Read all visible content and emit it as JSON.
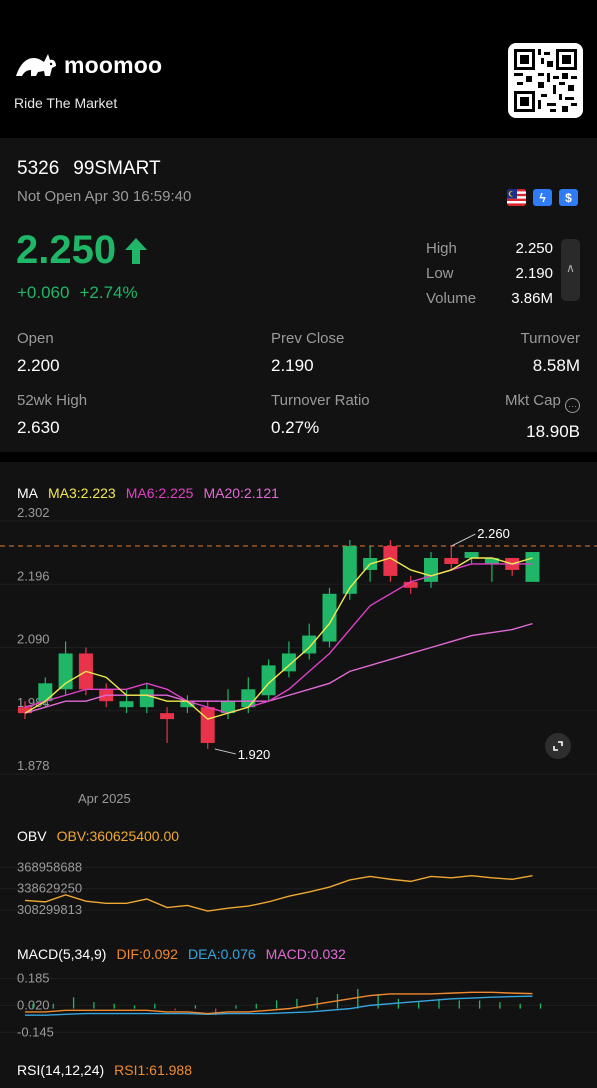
{
  "brand": {
    "name": "moomoo",
    "tagline": "Ride The Market"
  },
  "stock": {
    "code": "5326",
    "name": "99SMART",
    "status": "Not Open Apr 30 16:59:40",
    "price": "2.250",
    "change": "+0.060",
    "change_pct": "+2.74%",
    "high_label": "High",
    "high": "2.250",
    "low_label": "Low",
    "low": "2.190",
    "volume_label": "Volume",
    "volume": "3.86M",
    "open_label": "Open",
    "open": "2.200",
    "prev_close_label": "Prev Close",
    "prev_close": "2.190",
    "turnover_label": "Turnover",
    "turnover": "8.58M",
    "wk52_high_label": "52wk High",
    "wk52_high": "2.630",
    "turnover_ratio_label": "Turnover Ratio",
    "turnover_ratio": "0.27%",
    "mkt_cap_label": "Mkt Cap",
    "mkt_cap": "18.90B",
    "badges": [
      "malaysia-flag",
      "lightning-badge",
      "dollar-badge"
    ]
  },
  "colors": {
    "up": "#1fb667",
    "down": "#e8334a",
    "ma3": "#f2e94e",
    "ma6": "#e040c8",
    "ma20": "#e26ad6",
    "obv": "#f0a830",
    "dif": "#f08a30",
    "dea": "#36a6e0",
    "macd": "#e26ad6",
    "rsi": "#f08a30"
  },
  "ma_legend": {
    "title": "MA",
    "ma3": "MA3:2.223",
    "ma6": "MA6:2.225",
    "ma20": "MA20:2.121"
  },
  "obv_legend": {
    "title": "OBV",
    "obv": "OBV:360625400.00"
  },
  "macd_legend": {
    "title": "MACD(5,34,9)",
    "dif": "DIF:0.092",
    "dea": "DEA:0.076",
    "macd": "MACD:0.032"
  },
  "rsi_legend": {
    "title": "RSI(14,12,24)",
    "rsi1": "RSI1:61.988"
  },
  "chart_data": [
    {
      "type": "candlestick",
      "title": "MA",
      "y_ticks": [
        "2.302",
        "2.196",
        "2.090",
        "1.984",
        "1.878"
      ],
      "ylim": [
        1.878,
        2.302
      ],
      "x_label": "Apr 2025",
      "max_label": "2.260",
      "min_label": "1.920",
      "reference_line": 2.26,
      "candles": [
        {
          "o": 1.99,
          "c": 1.98,
          "h": 2.0,
          "l": 1.97
        },
        {
          "o": 2.0,
          "c": 2.03,
          "h": 2.04,
          "l": 1.99
        },
        {
          "o": 2.02,
          "c": 2.08,
          "h": 2.1,
          "l": 2.01
        },
        {
          "o": 2.08,
          "c": 2.02,
          "h": 2.09,
          "l": 2.01
        },
        {
          "o": 2.02,
          "c": 2.0,
          "h": 2.03,
          "l": 1.99
        },
        {
          "o": 1.99,
          "c": 2.0,
          "h": 2.02,
          "l": 1.98
        },
        {
          "o": 1.99,
          "c": 2.02,
          "h": 2.03,
          "l": 1.98
        },
        {
          "o": 1.98,
          "c": 1.97,
          "h": 1.99,
          "l": 1.93
        },
        {
          "o": 1.99,
          "c": 2.0,
          "h": 2.01,
          "l": 1.98
        },
        {
          "o": 1.99,
          "c": 1.93,
          "h": 2.0,
          "l": 1.92
        },
        {
          "o": 1.98,
          "c": 2.0,
          "h": 2.02,
          "l": 1.97
        },
        {
          "o": 1.99,
          "c": 2.02,
          "h": 2.04,
          "l": 1.98
        },
        {
          "o": 2.01,
          "c": 2.06,
          "h": 2.07,
          "l": 2.0
        },
        {
          "o": 2.05,
          "c": 2.08,
          "h": 2.1,
          "l": 2.04
        },
        {
          "o": 2.08,
          "c": 2.11,
          "h": 2.13,
          "l": 2.07
        },
        {
          "o": 2.1,
          "c": 2.18,
          "h": 2.19,
          "l": 2.09
        },
        {
          "o": 2.18,
          "c": 2.26,
          "h": 2.27,
          "l": 2.17
        },
        {
          "o": 2.22,
          "c": 2.24,
          "h": 2.26,
          "l": 2.2
        },
        {
          "o": 2.26,
          "c": 2.21,
          "h": 2.27,
          "l": 2.2
        },
        {
          "o": 2.2,
          "c": 2.19,
          "h": 2.21,
          "l": 2.18
        },
        {
          "o": 2.2,
          "c": 2.24,
          "h": 2.25,
          "l": 2.19
        },
        {
          "o": 2.24,
          "c": 2.23,
          "h": 2.26,
          "l": 2.22
        },
        {
          "o": 2.24,
          "c": 2.25,
          "h": 2.25,
          "l": 2.23
        },
        {
          "o": 2.23,
          "c": 2.24,
          "h": 2.24,
          "l": 2.2
        },
        {
          "o": 2.24,
          "c": 2.22,
          "h": 2.24,
          "l": 2.21
        },
        {
          "o": 2.2,
          "c": 2.25,
          "h": 2.25,
          "l": 2.2
        }
      ],
      "ma3": [
        1.98,
        2.0,
        2.03,
        2.05,
        2.04,
        2.01,
        2.01,
        2.0,
        2.0,
        1.97,
        1.98,
        1.99,
        2.03,
        2.06,
        2.09,
        2.13,
        2.19,
        2.23,
        2.24,
        2.22,
        2.21,
        2.22,
        2.24,
        2.24,
        2.23,
        2.24
      ],
      "ma6": [
        1.99,
        2.0,
        2.01,
        2.02,
        2.02,
        2.02,
        2.03,
        2.02,
        2.0,
        1.99,
        1.98,
        1.99,
        2.0,
        2.02,
        2.05,
        2.08,
        2.12,
        2.16,
        2.18,
        2.2,
        2.21,
        2.22,
        2.23,
        2.23,
        2.23,
        2.23
      ],
      "ma20": [
        1.98,
        1.99,
        2.0,
        2.0,
        2.01,
        2.01,
        2.01,
        2.01,
        2.0,
        2.0,
        2.0,
        2.0,
        2.0,
        2.01,
        2.02,
        2.03,
        2.05,
        2.06,
        2.07,
        2.08,
        2.09,
        2.1,
        2.11,
        2.115,
        2.12,
        2.13
      ]
    },
    {
      "type": "line",
      "title": "OBV",
      "y_ticks": [
        "368958688",
        "338629250",
        "308299813"
      ],
      "ylim": [
        300000000,
        375000000
      ],
      "obv": [
        322000000,
        320000000,
        330000000,
        321000000,
        318000000,
        318000000,
        324000000,
        312000000,
        315000000,
        307000000,
        311000000,
        314000000,
        320000000,
        328000000,
        334000000,
        341000000,
        351000000,
        356000000,
        352000000,
        349000000,
        356000000,
        354000000,
        357000000,
        354000000,
        352000000,
        357000000
      ]
    },
    {
      "type": "bar+line",
      "title": "MACD(5,34,9)",
      "y_ticks": [
        "0.185",
        "0.020",
        "-0.145"
      ],
      "ylim": [
        -0.18,
        0.2
      ],
      "macd": [
        0.03,
        0.03,
        0.07,
        0.04,
        0.03,
        0.02,
        0.03,
        -0.01,
        0.02,
        -0.04,
        0.02,
        0.03,
        0.05,
        0.06,
        0.07,
        0.09,
        0.12,
        0.09,
        0.06,
        0.04,
        0.06,
        0.05,
        0.05,
        0.04,
        0.03,
        0.032
      ],
      "dif": [
        -0.02,
        -0.02,
        -0.01,
        -0.01,
        -0.01,
        -0.01,
        -0.01,
        -0.02,
        -0.02,
        -0.03,
        -0.02,
        -0.02,
        -0.01,
        0.0,
        0.02,
        0.04,
        0.06,
        0.08,
        0.09,
        0.09,
        0.09,
        0.095,
        0.1,
        0.1,
        0.095,
        0.092
      ],
      "dea": [
        -0.04,
        -0.04,
        -0.035,
        -0.03,
        -0.03,
        -0.03,
        -0.03,
        -0.03,
        -0.03,
        -0.035,
        -0.03,
        -0.03,
        -0.03,
        -0.025,
        -0.02,
        -0.01,
        0.0,
        0.02,
        0.03,
        0.04,
        0.05,
        0.06,
        0.065,
        0.07,
        0.074,
        0.076
      ]
    }
  ]
}
